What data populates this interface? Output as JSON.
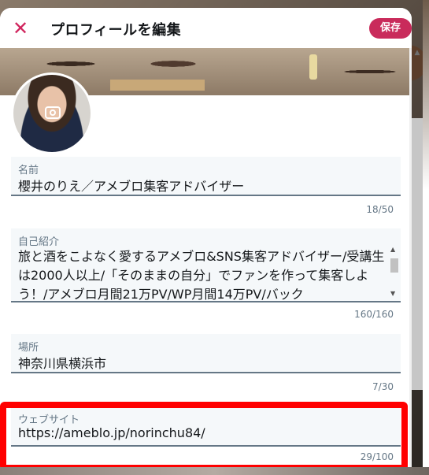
{
  "header": {
    "title": "プロフィールを編集",
    "save_label": "保存",
    "close_glyph": "✕"
  },
  "fields": {
    "name": {
      "label": "名前",
      "value": "櫻井のりえ／アメブロ集客アドバイザー",
      "count": "18/50"
    },
    "bio": {
      "label": "自己紹介",
      "value": "旅と酒をこよなく愛するアメブロ&SNS集客アドバイザー/受講生は2000人以上/「そのままの自分」でファンを作って集客しよう！/アメブロ月間21万PV/WP月間14万PV/バック",
      "count": "160/160"
    },
    "location": {
      "label": "場所",
      "value": "神奈川県横浜市",
      "count": "7/30"
    },
    "website": {
      "label": "ウェブサイト",
      "value": "https://ameblo.jp/norinchu84/",
      "count": "29/100"
    }
  },
  "colors": {
    "accent": "#c92b5b",
    "close": "#d0245d",
    "highlight": "#ff0000"
  },
  "icons": {
    "close": "close-icon",
    "camera": "camera-icon"
  }
}
